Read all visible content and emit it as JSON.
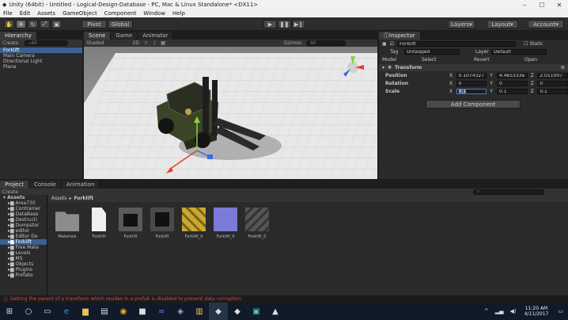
{
  "window": {
    "title": "Unity (64bit) - Untitled - Logical-Design-Database - PC, Mac & Linux Standalone* <DX11>"
  },
  "menu": [
    "File",
    "Edit",
    "Assets",
    "GameObject",
    "Component",
    "Window",
    "Help"
  ],
  "toolbar": {
    "pivot": "Pivot",
    "global": "Global",
    "layers": "Layers",
    "layout": "Layout",
    "account": "Account"
  },
  "hierarchy": {
    "tab": "Hierarchy",
    "create": "Create",
    "search": "All",
    "items": [
      "Forklift",
      "Main Camera",
      "Directional Light",
      "Plane"
    ]
  },
  "scene": {
    "tabs": [
      "Scene",
      "Game",
      "Animator"
    ],
    "shading": "Shaded",
    "mode2d": "2D",
    "gizmos": "Gizmos",
    "search": "All",
    "persp": "Persp"
  },
  "inspector": {
    "tab": "Inspector",
    "name": "Forklift",
    "static": "Static",
    "tag_label": "Tag",
    "tag": "Untagged",
    "layer_label": "Layer",
    "layer": "Default",
    "model_label": "Model",
    "select": "Select",
    "revert": "Revert",
    "open": "Open",
    "transform": "Transform",
    "rows": [
      {
        "label": "Position",
        "x": "0.1074327",
        "y": "4.465333e",
        "z": "2.011007"
      },
      {
        "label": "Rotation",
        "x": "0",
        "y": "0",
        "z": "0"
      },
      {
        "label": "Scale",
        "x": "0.1",
        "y": "0.1",
        "z": "0.1"
      }
    ],
    "add_component": "Add Component"
  },
  "project": {
    "tabs": [
      "Project",
      "Console",
      "Animation"
    ],
    "create": "Create",
    "favorite_assets": "Assets",
    "tree": [
      "Area730",
      "Contrainer",
      "DataBase",
      "Destructi",
      "Dumpster",
      "editor",
      "Editor De",
      "Forklift",
      "Free Mate",
      "Levels",
      "MS",
      "Objects",
      "Plugins",
      "Prefabs"
    ],
    "breadcrumb": [
      "Assets",
      "Forklift"
    ],
    "assets": [
      "Materials",
      "Forklift",
      "Forklift",
      "Forklift",
      "Forklift_0",
      "Forklift_0",
      "Forklift_0"
    ]
  },
  "status": "Setting the parent of a transform which resides in a prefab is disabled to prevent data corruption.",
  "clock": {
    "time": "11:20 AM",
    "date": "4/11/2017"
  },
  "colors": {
    "selection": "#3d5f91",
    "error": "#e04a3a"
  }
}
